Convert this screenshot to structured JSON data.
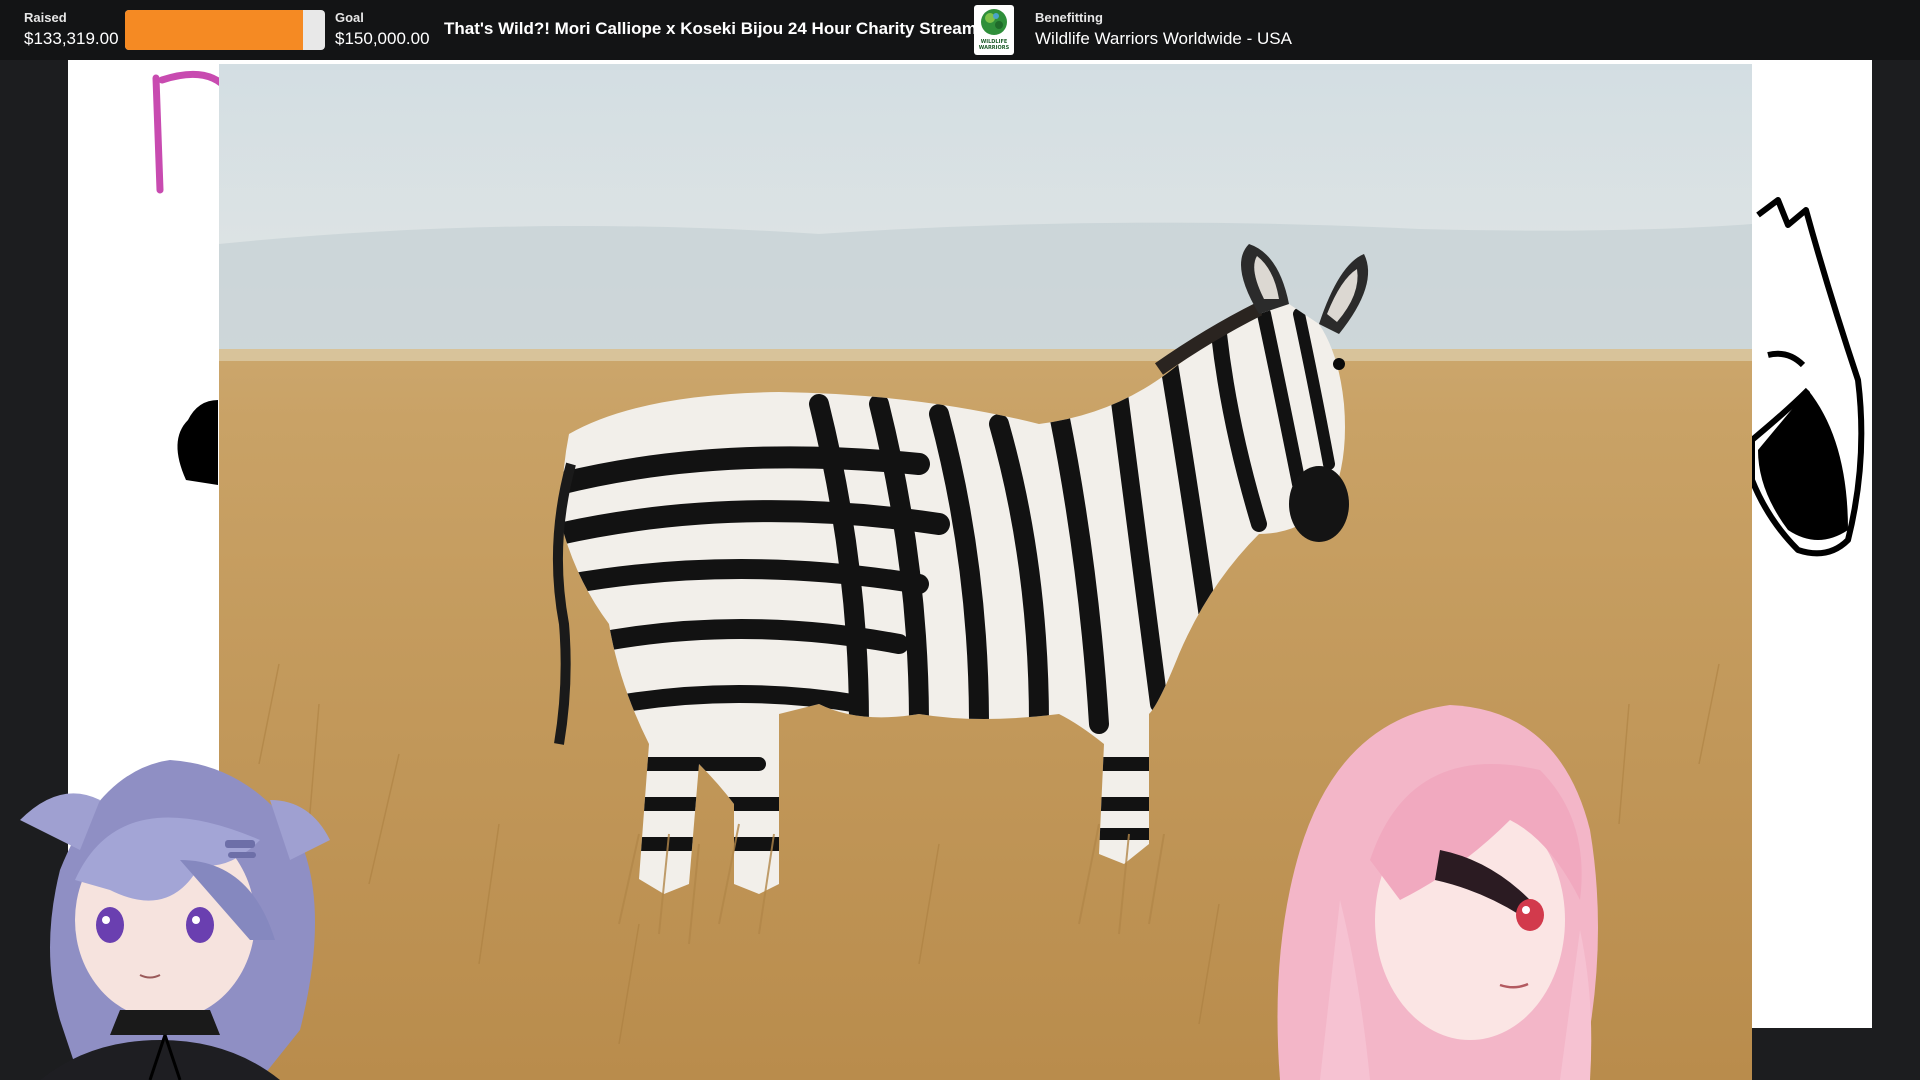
{
  "charity_bar": {
    "raised_label": "Raised",
    "raised_value": "$133,319.00",
    "goal_label": "Goal",
    "goal_value": "$150,000.00",
    "progress_fraction": 0.889,
    "title": "That's Wild?! Mori Calliope x Koseki Bijou 24 Hour Charity Stream",
    "benefit_label": "Benefitting",
    "benefit_name": "Wildlife Warriors Worldwide - USA",
    "logo_text_line1": "WILDLIFE",
    "logo_text_line2": "WARRIORS"
  },
  "colors": {
    "bar_bg": "#131415",
    "progress_fill": "#f58a23",
    "progress_track": "#e8e8e8"
  }
}
